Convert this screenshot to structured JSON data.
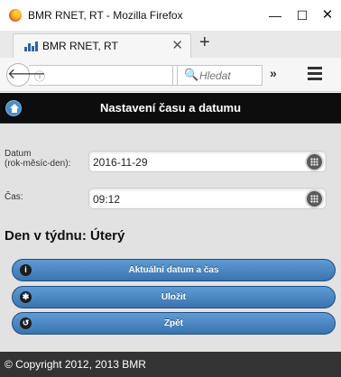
{
  "window": {
    "title": "BMR RNET, RT - Mozilla Firefox",
    "min_glyph": "—",
    "max_glyph": "☐",
    "close_glyph": "✕"
  },
  "tab": {
    "title": "BMR RNET, RT",
    "close_glyph": "✕",
    "new_tab_glyph": "+"
  },
  "navbar": {
    "back_glyph": "🡐",
    "info_glyph": "ⓘ",
    "reload_glyph": "C",
    "search_glyph": "🔍",
    "search_placeholder": "Hledat",
    "overflow_glyph": "»"
  },
  "page": {
    "title": "Nastavení času a datumu",
    "date_label_line1": "Datum",
    "date_label_line2": "(rok-měsíc-den):",
    "date_value": "2016-11-29",
    "time_label": "Čas:",
    "time_value": "09:12",
    "day_of_week": "Den v týdnu: Úterý",
    "buttons": {
      "current": "Aktuální datum a čas",
      "save": "Uložit",
      "back": "Zpět"
    },
    "button_icons": {
      "current": "i",
      "save": "✱",
      "back": "↺"
    },
    "footer": "© Copyright 2012, 2013 BMR"
  },
  "colors": {
    "header_bg": "#0d0d0d",
    "button_blue": "#3a74b0",
    "page_bg": "#e2e2e2",
    "footer_bg": "#333333"
  }
}
